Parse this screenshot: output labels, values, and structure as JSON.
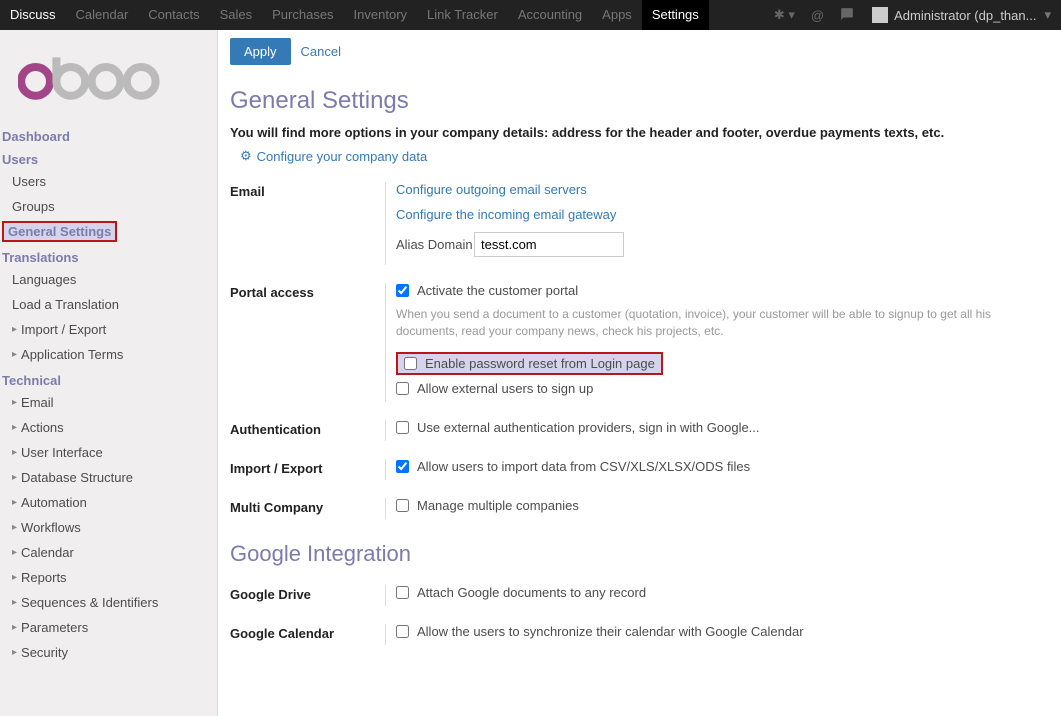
{
  "topnav": {
    "items": [
      "Discuss",
      "Calendar",
      "Contacts",
      "Sales",
      "Purchases",
      "Inventory",
      "Link Tracker",
      "Accounting",
      "Apps",
      "Settings"
    ],
    "active_index": 0,
    "selected_index": 9,
    "user": "Administrator (dp_than..."
  },
  "sidebar": {
    "sections": [
      {
        "title": "Dashboard",
        "items": []
      },
      {
        "title": "Users",
        "items": [
          {
            "label": "Users"
          },
          {
            "label": "Groups"
          }
        ]
      },
      {
        "title_highlighted": true,
        "title": "General Settings",
        "items": []
      },
      {
        "title": "Translations",
        "items": [
          {
            "label": "Languages"
          },
          {
            "label": "Load a Translation"
          },
          {
            "label": "Import / Export",
            "caret": true
          },
          {
            "label": "Application Terms",
            "caret": true
          }
        ]
      },
      {
        "title": "Technical",
        "items": [
          {
            "label": "Email",
            "caret": true
          },
          {
            "label": "Actions",
            "caret": true
          },
          {
            "label": "User Interface",
            "caret": true
          },
          {
            "label": "Database Structure",
            "caret": true
          },
          {
            "label": "Automation",
            "caret": true
          },
          {
            "label": "Workflows",
            "caret": true
          },
          {
            "label": "Calendar",
            "caret": true
          },
          {
            "label": "Reports",
            "caret": true
          },
          {
            "label": "Sequences & Identifiers",
            "caret": true
          },
          {
            "label": "Parameters",
            "caret": true
          },
          {
            "label": "Security",
            "caret": true
          }
        ]
      }
    ]
  },
  "actions": {
    "apply": "Apply",
    "cancel": "Cancel"
  },
  "page": {
    "title": "General Settings",
    "subtitle": "You will find more options in your company details: address for the header and footer, overdue payments texts, etc.",
    "config_link": "Configure your company data",
    "sections": {
      "email": {
        "label": "Email",
        "outgoing_link": "Configure outgoing email servers",
        "incoming_link": "Configure the incoming email gateway",
        "alias_label": "Alias Domain",
        "alias_value": "tesst.com"
      },
      "portal": {
        "label": "Portal access",
        "activate_label": "Activate the customer portal",
        "activate_checked": true,
        "help": "When you send a document to a customer (quotation, invoice), your customer will be able to signup to get all his documents, read your company news, check his projects, etc.",
        "reset_label": "Enable password reset from Login page",
        "reset_checked": false,
        "signup_label": "Allow external users to sign up",
        "signup_checked": false
      },
      "auth": {
        "label": "Authentication",
        "external_label": "Use external authentication providers, sign in with Google...",
        "external_checked": false
      },
      "import": {
        "label": "Import / Export",
        "allow_label": "Allow users to import data from CSV/XLS/XLSX/ODS files",
        "allow_checked": true
      },
      "multi": {
        "label": "Multi Company",
        "manage_label": "Manage multiple companies",
        "manage_checked": false
      }
    },
    "google_title": "Google Integration",
    "google": {
      "drive": {
        "label": "Google Drive",
        "attach_label": "Attach Google documents to any record",
        "attach_checked": false
      },
      "calendar": {
        "label": "Google Calendar",
        "sync_label": "Allow the users to synchronize their calendar with Google Calendar",
        "sync_checked": false
      }
    }
  }
}
